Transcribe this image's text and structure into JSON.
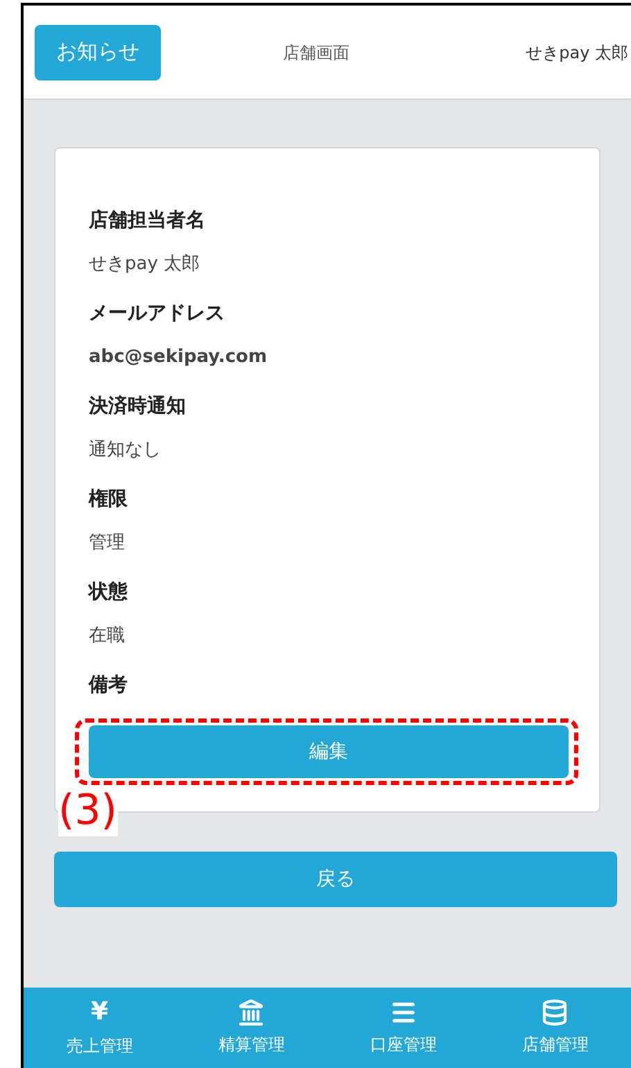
{
  "header": {
    "notice_button": "お知らせ",
    "title": "店舗画面",
    "user": "せきpay 太郎"
  },
  "fields": [
    {
      "label": "店舗担当者名",
      "value": "せきpay 太郎"
    },
    {
      "label": "メールアドレス",
      "value": "abc@sekipay.com"
    },
    {
      "label": "決済時通知",
      "value": "通知なし"
    },
    {
      "label": "権限",
      "value": "管理"
    },
    {
      "label": "状態",
      "value": "在職"
    },
    {
      "label": "備考"
    }
  ],
  "edit_button": "編集",
  "annotation": "(3)",
  "back_button": "戻る",
  "bottom_nav": [
    {
      "kind": "yen",
      "glyph": "¥",
      "label": "売上管理"
    },
    {
      "kind": "bank",
      "label": "精算管理"
    },
    {
      "kind": "list",
      "label": "口座管理"
    },
    {
      "kind": "database",
      "label": "店舗管理"
    }
  ]
}
